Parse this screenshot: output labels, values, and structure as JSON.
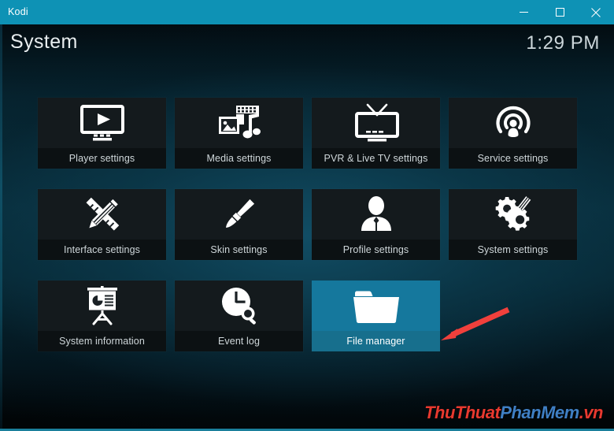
{
  "window": {
    "app_title": "Kodi",
    "controls": [
      {
        "name": "minimize",
        "glyph": "minimize-icon",
        "label": "Minimize"
      },
      {
        "name": "maximize",
        "glyph": "maximize-icon",
        "label": "Maximize"
      },
      {
        "name": "close",
        "glyph": "close-icon",
        "label": "Close"
      }
    ],
    "titlebar_color": "#0e92b5"
  },
  "header": {
    "page_title": "System",
    "clock": "1:29 PM"
  },
  "grid": {
    "columns": 4,
    "rows": 3,
    "tiles": [
      {
        "label": "Player settings",
        "icon": "tv-play-icon",
        "selected": false
      },
      {
        "label": "Media settings",
        "icon": "media-photo-music-icon",
        "selected": false
      },
      {
        "label": "PVR & Live TV settings",
        "icon": "tv-antenna-icon",
        "selected": false
      },
      {
        "label": "Service settings",
        "icon": "broadcast-person-icon",
        "selected": false
      },
      {
        "label": "Interface settings",
        "icon": "pencil-ruler-icon",
        "selected": false
      },
      {
        "label": "Skin settings",
        "icon": "paintbrush-icon",
        "selected": false
      },
      {
        "label": "Profile settings",
        "icon": "person-icon",
        "selected": false
      },
      {
        "label": "System settings",
        "icon": "gears-screwdriver-icon",
        "selected": false
      },
      {
        "label": "System information",
        "icon": "presentation-chart-icon",
        "selected": false
      },
      {
        "label": "Event log",
        "icon": "clock-search-icon",
        "selected": false
      },
      {
        "label": "File manager",
        "icon": "folder-icon",
        "selected": true
      }
    ],
    "selected_label": "File manager",
    "selected_color": "#15789d"
  },
  "annotation": {
    "arrow": {
      "name": "red-arrow",
      "color": "#f0403c",
      "points_to": "File manager"
    }
  },
  "watermark": {
    "part1": "ThuThuat",
    "part2": "PhanMem",
    "part3": ".vn",
    "color1": "#e8392f",
    "color2": "#3f7fc4"
  }
}
